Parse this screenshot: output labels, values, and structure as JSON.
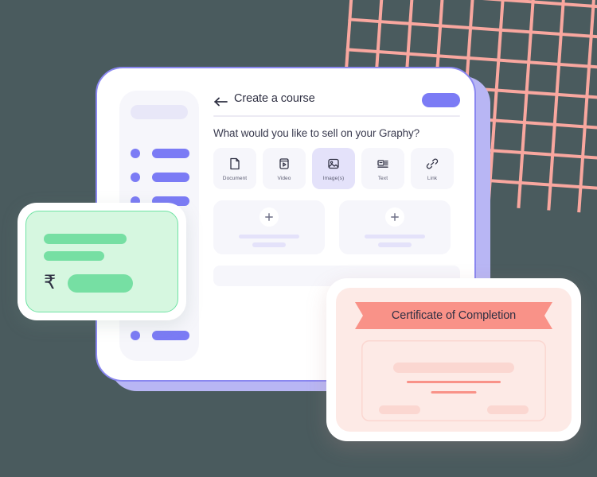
{
  "background": {
    "grid_color": "#f9a79f",
    "canvas_color": "#4a5b5e"
  },
  "app_card": {
    "accent_color": "#7b7bf5",
    "back_layer_color": "#b8b6f4",
    "sidebar": {
      "items": [
        {
          "label": ""
        },
        {
          "label": ""
        },
        {
          "label": ""
        },
        {
          "label": ""
        }
      ]
    },
    "topbar": {
      "back_label": "",
      "title": "Create a course",
      "action_label": ""
    },
    "question": "What would you like to sell on your Graphy?",
    "type_tabs": [
      {
        "label": "Document",
        "icon": "document-icon",
        "selected": false
      },
      {
        "label": "Video",
        "icon": "video-icon",
        "selected": false
      },
      {
        "label": "Image(s)",
        "icon": "image-icon",
        "selected": true
      },
      {
        "label": "Text",
        "icon": "text-icon",
        "selected": false
      },
      {
        "label": "Link",
        "icon": "link-icon",
        "selected": false
      }
    ],
    "upload_cards": [
      {
        "add_label": "+"
      },
      {
        "add_label": "+"
      }
    ]
  },
  "payment_card": {
    "currency_symbol": "₹",
    "accent_color": "#76dfa3",
    "panel_color": "#d6f7e0"
  },
  "certificate_card": {
    "title": "Certificate of Completion",
    "ribbon_color": "#f99288",
    "panel_color": "#fdeae6"
  }
}
